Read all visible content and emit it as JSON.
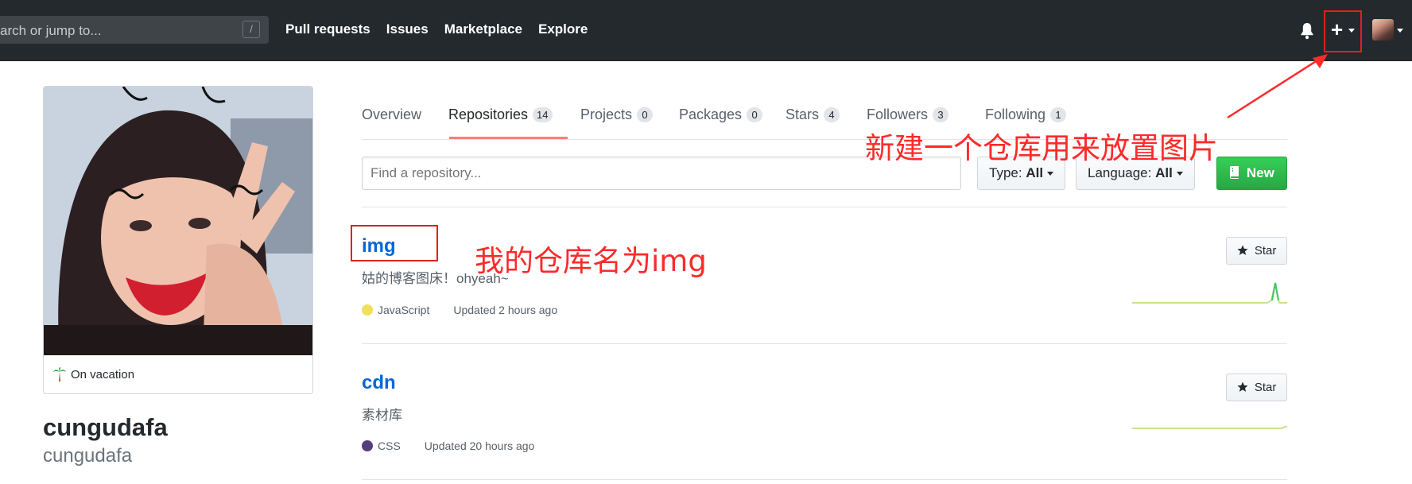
{
  "header": {
    "search_placeholder": "arch or jump to...",
    "search_shortcut": "/",
    "nav_items": [
      "Pull requests",
      "Issues",
      "Marketplace",
      "Explore"
    ],
    "plus_glyph": "+"
  },
  "profile": {
    "status": "On vacation",
    "name": "cungudafa",
    "login": "cungudafa"
  },
  "tabs": [
    {
      "label": "Overview",
      "count": ""
    },
    {
      "label": "Repositories",
      "count": "14"
    },
    {
      "label": "Projects",
      "count": "0"
    },
    {
      "label": "Packages",
      "count": "0"
    },
    {
      "label": "Stars",
      "count": "4"
    },
    {
      "label": "Followers",
      "count": "3"
    },
    {
      "label": "Following",
      "count": "1"
    }
  ],
  "filters": {
    "find_placeholder": "Find a repository...",
    "type_label": "Type:",
    "type_value": "All",
    "language_label": "Language:",
    "language_value": "All",
    "new_label": "New"
  },
  "repos": [
    {
      "name": "img",
      "description": "姑的博客图床！ohyeah~",
      "language": "JavaScript",
      "language_color": "#f1e05a",
      "updated": "Updated 2 hours ago",
      "star_label": "Star"
    },
    {
      "name": "cdn",
      "description": "素材库",
      "language": "CSS",
      "language_color": "#563d7c",
      "updated": "Updated 20 hours ago",
      "star_label": "Star"
    }
  ],
  "annotations": {
    "new_repo_note": "新建一个仓库用来放置图片",
    "repo_name_note": "我的仓库名为img",
    "color": "#ff2a2a"
  },
  "colors": {
    "header_bg": "#24292e",
    "link": "#0366d6",
    "new_button": "#28a745",
    "tab_underline": "#f9826c"
  },
  "icons": [
    "bell-icon",
    "plus-icon",
    "palm-tree-icon",
    "repo-icon",
    "star-icon",
    "caret-icon"
  ]
}
